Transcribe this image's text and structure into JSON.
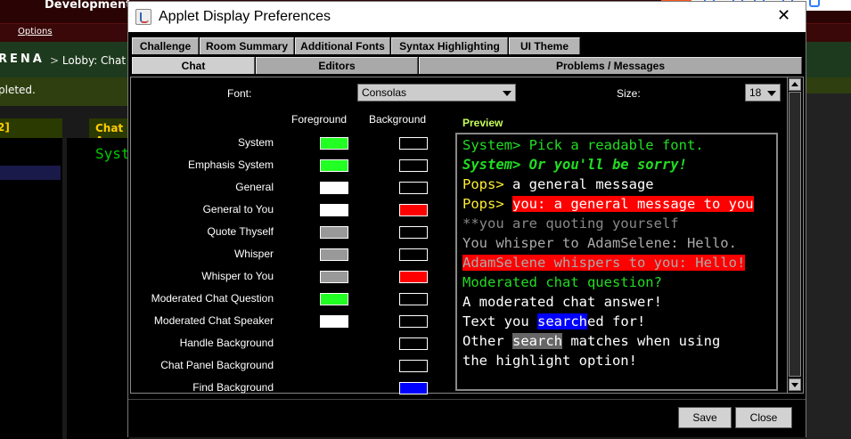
{
  "background": {
    "app_title": "Development",
    "menu_options": "Options",
    "arena_label": "RENA",
    "breadcrumb_prefix": ">",
    "breadcrumb": "Lobby: Chat R",
    "status_text": "pleted.",
    "left_panel_head": "2]",
    "right_panel_head": "Chat A",
    "chat_text": "Syst"
  },
  "dialog": {
    "title": "Applet Display Preferences",
    "close_glyph": "✕",
    "tabs_row1": [
      "Challenge",
      "Room Summary",
      "Additional Fonts",
      "Syntax Highlighting",
      "UI Theme"
    ],
    "tabs_row2": [
      "Chat",
      "Editors",
      "Problems / Messages"
    ],
    "active_tab": "Chat",
    "font_label": "Font:",
    "font_value": "Consolas",
    "size_label": "Size:",
    "size_value": "18",
    "foreground_header": "Foreground",
    "background_header": "Background",
    "preview_label": "Preview",
    "rows": [
      {
        "label": "System",
        "fg": "#22ff22",
        "bg": "#000000"
      },
      {
        "label": "Emphasis System",
        "fg": "#22ff22",
        "bg": "#000000"
      },
      {
        "label": "General",
        "fg": "#ffffff",
        "bg": "#000000"
      },
      {
        "label": "General to You",
        "fg": "#ffffff",
        "bg": "#ff0000"
      },
      {
        "label": "Quote Thyself",
        "fg": "#999999",
        "bg": "#000000"
      },
      {
        "label": "Whisper",
        "fg": "#999999",
        "bg": "#000000"
      },
      {
        "label": "Whisper to You",
        "fg": "#999999",
        "bg": "#ff0000"
      },
      {
        "label": "Moderated Chat Question",
        "fg": "#22ff22",
        "bg": "#000000"
      },
      {
        "label": "Moderated Chat Speaker",
        "fg": "#ffffff",
        "bg": "#000000"
      },
      {
        "label": "Handle Background",
        "fg": null,
        "bg": "#000000"
      },
      {
        "label": "Chat Panel Background",
        "fg": null,
        "bg": "#000000"
      },
      {
        "label": "Find Background",
        "fg": null,
        "bg": "#0000ff"
      }
    ],
    "preview_lines": [
      [
        {
          "t": "System> Pick a readable font.",
          "c": "#22dd22"
        }
      ],
      [
        {
          "t": "System> Or you'll be sorry!",
          "c": "#22dd22",
          "b": true,
          "i": true
        }
      ],
      [
        {
          "t": "Pops>",
          "c": "#ffee33"
        },
        {
          "t": " a general message",
          "c": "#ffffff"
        }
      ],
      [
        {
          "t": "Pops>",
          "c": "#ffee33"
        },
        {
          "t": " "
        },
        {
          "t": "you: a general message to you",
          "c": "#ffffff",
          "bg": "#ff0000"
        }
      ],
      [
        {
          "t": "**you are quoting yourself",
          "c": "#888888"
        }
      ],
      [
        {
          "t": "You whisper to AdamSelene: Hello.",
          "c": "#aaaaaa"
        }
      ],
      [
        {
          "t": "AdamSelene whispers to you: Hello!",
          "c": "#aaaaaa",
          "bg": "#ff0000"
        }
      ],
      [
        {
          "t": "Moderated chat question?",
          "c": "#22dd22"
        }
      ],
      [
        {
          "t": "A moderated chat answer!",
          "c": "#ffffff"
        }
      ],
      [
        {
          "t": "Text you ",
          "c": "#ffffff"
        },
        {
          "t": "search",
          "c": "#ffffff",
          "bg": "#0000ff"
        },
        {
          "t": "ed for!",
          "c": "#ffffff"
        }
      ],
      [
        {
          "t": "Other ",
          "c": "#ffffff"
        },
        {
          "t": "search",
          "c": "#ffffff",
          "bg": "#666666"
        },
        {
          "t": " matches when using",
          "c": "#ffffff"
        }
      ],
      [
        {
          "t": "the highlight option!",
          "c": "#ffffff"
        }
      ]
    ],
    "save_label": "Save",
    "close_label": "Close"
  }
}
